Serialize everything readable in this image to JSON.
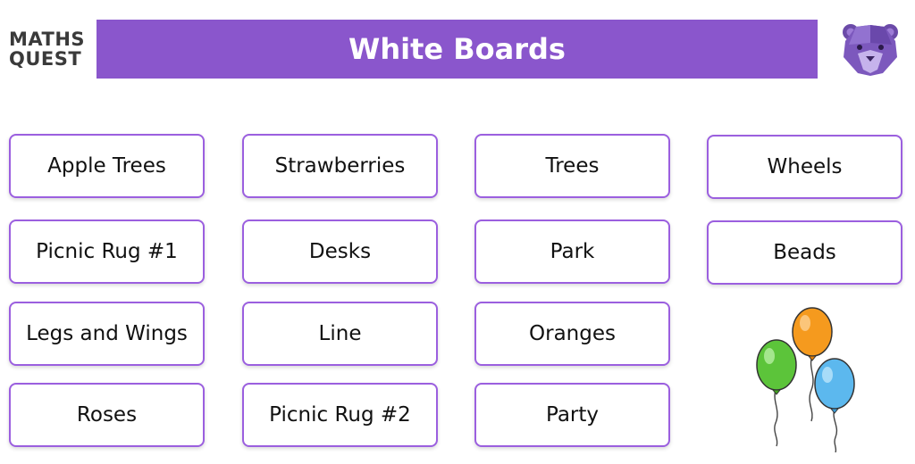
{
  "logo": {
    "line1": "MATHS",
    "line2": "QUEST"
  },
  "header": {
    "title": "White Boards"
  },
  "colors": {
    "banner": "#8a56cc",
    "card_border": "#9b5fdf"
  },
  "icons": {
    "mascot": "bear-mascot-icon",
    "decoration": "balloons-icon"
  },
  "cards": [
    "Apple Trees",
    "Strawberries",
    "Trees",
    "Wheels",
    "Picnic Rug #1",
    "Desks",
    "Park",
    "Beads",
    "Legs and Wings",
    "Line",
    "Oranges",
    "Roses",
    "Picnic Rug #2",
    "Party"
  ]
}
